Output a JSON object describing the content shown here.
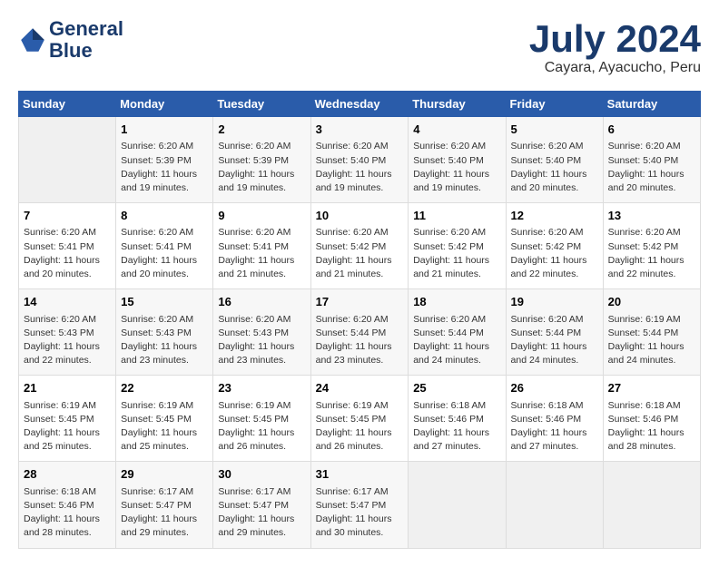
{
  "header": {
    "logo_line1": "General",
    "logo_line2": "Blue",
    "month": "July 2024",
    "location": "Cayara, Ayacucho, Peru"
  },
  "days_of_week": [
    "Sunday",
    "Monday",
    "Tuesday",
    "Wednesday",
    "Thursday",
    "Friday",
    "Saturday"
  ],
  "weeks": [
    [
      {
        "day": "",
        "info": ""
      },
      {
        "day": "1",
        "info": "Sunrise: 6:20 AM\nSunset: 5:39 PM\nDaylight: 11 hours\nand 19 minutes."
      },
      {
        "day": "2",
        "info": "Sunrise: 6:20 AM\nSunset: 5:39 PM\nDaylight: 11 hours\nand 19 minutes."
      },
      {
        "day": "3",
        "info": "Sunrise: 6:20 AM\nSunset: 5:40 PM\nDaylight: 11 hours\nand 19 minutes."
      },
      {
        "day": "4",
        "info": "Sunrise: 6:20 AM\nSunset: 5:40 PM\nDaylight: 11 hours\nand 19 minutes."
      },
      {
        "day": "5",
        "info": "Sunrise: 6:20 AM\nSunset: 5:40 PM\nDaylight: 11 hours\nand 20 minutes."
      },
      {
        "day": "6",
        "info": "Sunrise: 6:20 AM\nSunset: 5:40 PM\nDaylight: 11 hours\nand 20 minutes."
      }
    ],
    [
      {
        "day": "7",
        "info": "Sunrise: 6:20 AM\nSunset: 5:41 PM\nDaylight: 11 hours\nand 20 minutes."
      },
      {
        "day": "8",
        "info": "Sunrise: 6:20 AM\nSunset: 5:41 PM\nDaylight: 11 hours\nand 20 minutes."
      },
      {
        "day": "9",
        "info": "Sunrise: 6:20 AM\nSunset: 5:41 PM\nDaylight: 11 hours\nand 21 minutes."
      },
      {
        "day": "10",
        "info": "Sunrise: 6:20 AM\nSunset: 5:42 PM\nDaylight: 11 hours\nand 21 minutes."
      },
      {
        "day": "11",
        "info": "Sunrise: 6:20 AM\nSunset: 5:42 PM\nDaylight: 11 hours\nand 21 minutes."
      },
      {
        "day": "12",
        "info": "Sunrise: 6:20 AM\nSunset: 5:42 PM\nDaylight: 11 hours\nand 22 minutes."
      },
      {
        "day": "13",
        "info": "Sunrise: 6:20 AM\nSunset: 5:42 PM\nDaylight: 11 hours\nand 22 minutes."
      }
    ],
    [
      {
        "day": "14",
        "info": "Sunrise: 6:20 AM\nSunset: 5:43 PM\nDaylight: 11 hours\nand 22 minutes."
      },
      {
        "day": "15",
        "info": "Sunrise: 6:20 AM\nSunset: 5:43 PM\nDaylight: 11 hours\nand 23 minutes."
      },
      {
        "day": "16",
        "info": "Sunrise: 6:20 AM\nSunset: 5:43 PM\nDaylight: 11 hours\nand 23 minutes."
      },
      {
        "day": "17",
        "info": "Sunrise: 6:20 AM\nSunset: 5:44 PM\nDaylight: 11 hours\nand 23 minutes."
      },
      {
        "day": "18",
        "info": "Sunrise: 6:20 AM\nSunset: 5:44 PM\nDaylight: 11 hours\nand 24 minutes."
      },
      {
        "day": "19",
        "info": "Sunrise: 6:20 AM\nSunset: 5:44 PM\nDaylight: 11 hours\nand 24 minutes."
      },
      {
        "day": "20",
        "info": "Sunrise: 6:19 AM\nSunset: 5:44 PM\nDaylight: 11 hours\nand 24 minutes."
      }
    ],
    [
      {
        "day": "21",
        "info": "Sunrise: 6:19 AM\nSunset: 5:45 PM\nDaylight: 11 hours\nand 25 minutes."
      },
      {
        "day": "22",
        "info": "Sunrise: 6:19 AM\nSunset: 5:45 PM\nDaylight: 11 hours\nand 25 minutes."
      },
      {
        "day": "23",
        "info": "Sunrise: 6:19 AM\nSunset: 5:45 PM\nDaylight: 11 hours\nand 26 minutes."
      },
      {
        "day": "24",
        "info": "Sunrise: 6:19 AM\nSunset: 5:45 PM\nDaylight: 11 hours\nand 26 minutes."
      },
      {
        "day": "25",
        "info": "Sunrise: 6:18 AM\nSunset: 5:46 PM\nDaylight: 11 hours\nand 27 minutes."
      },
      {
        "day": "26",
        "info": "Sunrise: 6:18 AM\nSunset: 5:46 PM\nDaylight: 11 hours\nand 27 minutes."
      },
      {
        "day": "27",
        "info": "Sunrise: 6:18 AM\nSunset: 5:46 PM\nDaylight: 11 hours\nand 28 minutes."
      }
    ],
    [
      {
        "day": "28",
        "info": "Sunrise: 6:18 AM\nSunset: 5:46 PM\nDaylight: 11 hours\nand 28 minutes."
      },
      {
        "day": "29",
        "info": "Sunrise: 6:17 AM\nSunset: 5:47 PM\nDaylight: 11 hours\nand 29 minutes."
      },
      {
        "day": "30",
        "info": "Sunrise: 6:17 AM\nSunset: 5:47 PM\nDaylight: 11 hours\nand 29 minutes."
      },
      {
        "day": "31",
        "info": "Sunrise: 6:17 AM\nSunset: 5:47 PM\nDaylight: 11 hours\nand 30 minutes."
      },
      {
        "day": "",
        "info": ""
      },
      {
        "day": "",
        "info": ""
      },
      {
        "day": "",
        "info": ""
      }
    ]
  ]
}
